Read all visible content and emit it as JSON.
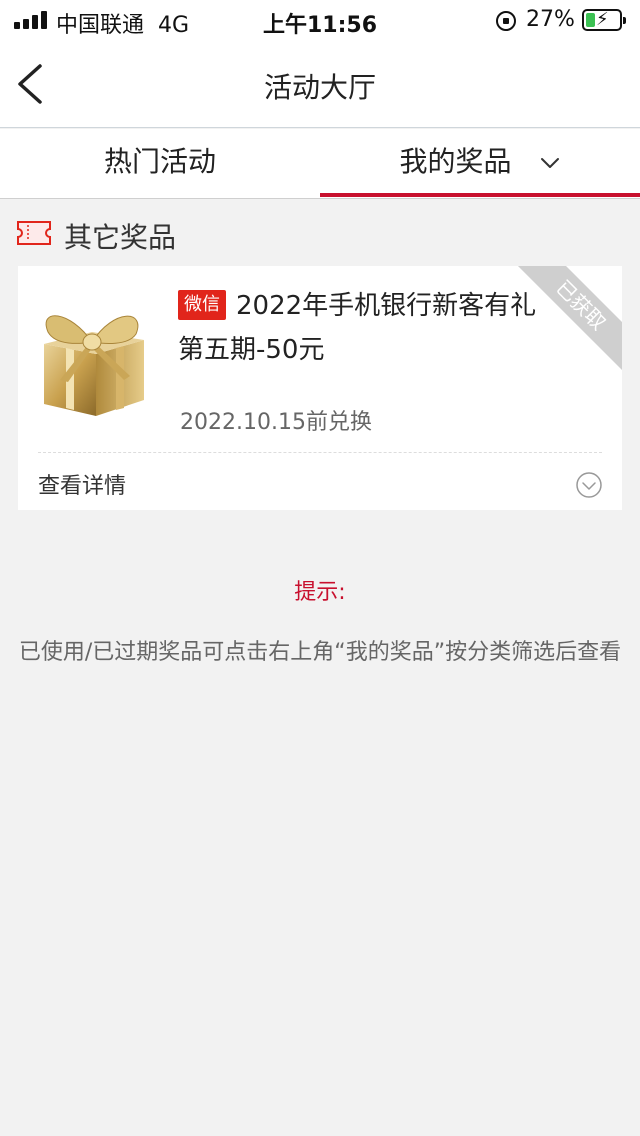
{
  "status_bar": {
    "carrier": "中国联通",
    "network": "4G",
    "time": "上午11:56",
    "battery_percent_label": "27%",
    "battery_level": 0.27
  },
  "nav": {
    "title": "活动大厅",
    "back_icon": "chevron-left-icon"
  },
  "tabs": [
    {
      "label": "热门活动",
      "active": false
    },
    {
      "label": "我的奖品",
      "active": true,
      "icon": "chevron-down-icon"
    }
  ],
  "section": {
    "label": "其它奖品",
    "icon": "ticket-icon"
  },
  "prize_card": {
    "badge": "微信",
    "title": "2022年手机银行新客有礼第五期-50元",
    "expiry": "2022.10.15前兑换",
    "detail_label": "查看详情",
    "ribbon": "已获取",
    "image": "gift-box-icon"
  },
  "tip": {
    "title": "提示:",
    "body": "已使用/已过期奖品可点击右上角“我的奖品”按分类筛选后查看"
  },
  "colors": {
    "accent": "#c8102e",
    "badge": "#e1251b",
    "background": "#f2f2f2"
  }
}
